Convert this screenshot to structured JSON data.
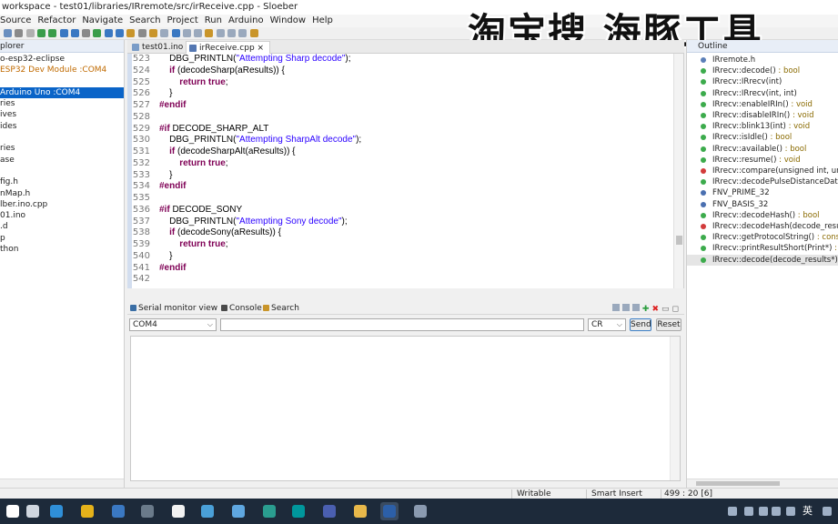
{
  "window": {
    "title": "workspace - test01/libraries/IRremote/src/irReceive.cpp - Sloeber"
  },
  "watermark": "淘宝搜 海豚工具",
  "menu": [
    "Source",
    "Refactor",
    "Navigate",
    "Search",
    "Project",
    "Run",
    "Arduino",
    "Window",
    "Help"
  ],
  "explorer": {
    "tab_label": "plorer",
    "items": [
      {
        "label": "o-esp32-eclipse"
      },
      {
        "label": " ESP32 Dev Module :COM4",
        "highlight": true
      },
      {
        "label": ""
      },
      {
        "label": "Arduino Uno :COM4",
        "selected": true
      },
      {
        "label": "ries"
      },
      {
        "label": "ives"
      },
      {
        "label": "ides"
      },
      {
        "label": ""
      },
      {
        "label": "ries"
      },
      {
        "label": "ase"
      },
      {
        "label": ""
      },
      {
        "label": "fig.h"
      },
      {
        "label": "nMap.h"
      },
      {
        "label": "lber.ino.cpp"
      },
      {
        "label": "01.ino"
      },
      {
        "label": ".d"
      },
      {
        "label": "p"
      },
      {
        "label": "thon"
      }
    ]
  },
  "editor": {
    "tabs": [
      {
        "label": "test01.ino",
        "active": false
      },
      {
        "label": "irReceive.cpp",
        "active": true
      }
    ],
    "lines": [
      {
        "n": "523",
        "parts": [
          [
            "t",
            "    DBG_PRINTLN("
          ],
          [
            "s",
            "\"Attempting Sharp decode\""
          ],
          [
            "t",
            ");"
          ]
        ]
      },
      {
        "n": "524",
        "parts": [
          [
            "k",
            "    if"
          ],
          [
            "t",
            " (decodeSharp(aResults)) {"
          ]
        ]
      },
      {
        "n": "525",
        "parts": [
          [
            "k",
            "        return true"
          ],
          [
            "t",
            ";"
          ]
        ]
      },
      {
        "n": "526",
        "parts": [
          [
            "t",
            "    }"
          ]
        ]
      },
      {
        "n": "527",
        "parts": [
          [
            "k",
            "#endif"
          ]
        ]
      },
      {
        "n": "528",
        "parts": [
          [
            "t",
            ""
          ]
        ]
      },
      {
        "n": "529",
        "parts": [
          [
            "k",
            "#if"
          ],
          [
            "t",
            " DECODE_SHARP_ALT"
          ]
        ]
      },
      {
        "n": "530",
        "parts": [
          [
            "t",
            "    DBG_PRINTLN("
          ],
          [
            "s",
            "\"Attempting SharpAlt decode\""
          ],
          [
            "t",
            ");"
          ]
        ]
      },
      {
        "n": "531",
        "parts": [
          [
            "k",
            "    if"
          ],
          [
            "t",
            " (decodeSharpAlt(aResults)) {"
          ]
        ]
      },
      {
        "n": "532",
        "parts": [
          [
            "k",
            "        return true"
          ],
          [
            "t",
            ";"
          ]
        ]
      },
      {
        "n": "533",
        "parts": [
          [
            "t",
            "    }"
          ]
        ]
      },
      {
        "n": "534",
        "parts": [
          [
            "k",
            "#endif"
          ]
        ]
      },
      {
        "n": "535",
        "parts": [
          [
            "t",
            ""
          ]
        ]
      },
      {
        "n": "536",
        "parts": [
          [
            "k",
            "#if"
          ],
          [
            "t",
            " DECODE_SONY"
          ]
        ]
      },
      {
        "n": "537",
        "parts": [
          [
            "t",
            "    DBG_PRINTLN("
          ],
          [
            "s",
            "\"Attempting Sony decode\""
          ],
          [
            "t",
            ");"
          ]
        ]
      },
      {
        "n": "538",
        "parts": [
          [
            "k",
            "    if"
          ],
          [
            "t",
            " (decodeSony(aResults)) {"
          ]
        ]
      },
      {
        "n": "539",
        "parts": [
          [
            "k",
            "        return true"
          ],
          [
            "t",
            ";"
          ]
        ]
      },
      {
        "n": "540",
        "parts": [
          [
            "t",
            "    }"
          ]
        ]
      },
      {
        "n": "541",
        "parts": [
          [
            "k",
            "#endif"
          ]
        ]
      },
      {
        "n": "542",
        "parts": [
          [
            "t",
            ""
          ]
        ]
      }
    ]
  },
  "bottom": {
    "tabs": [
      "Serial monitor view",
      "Console",
      "Search"
    ],
    "port": "COM4",
    "line_ending": "CR",
    "send_label": "Send",
    "reset_label": "Reset",
    "input_value": ""
  },
  "outline": {
    "tab_label": "Outline",
    "items": [
      {
        "name": "IRremote.h",
        "ret": "",
        "color": "#5b7fb8"
      },
      {
        "name": "IRrecv::decode()",
        "ret": " : bool",
        "color": "#3cab4c"
      },
      {
        "name": "IRrecv::IRrecv(int)",
        "ret": "",
        "color": "#3cab4c"
      },
      {
        "name": "IRrecv::IRrecv(int, int)",
        "ret": "",
        "color": "#3cab4c"
      },
      {
        "name": "IRrecv::enableIRIn()",
        "ret": " : void",
        "color": "#3cab4c"
      },
      {
        "name": "IRrecv::disableIRIn()",
        "ret": " : void",
        "color": "#3cab4c"
      },
      {
        "name": "IRrecv::blink13(int)",
        "ret": " : void",
        "color": "#3cab4c"
      },
      {
        "name": "IRrecv::isIdle()",
        "ret": " : bool",
        "color": "#3cab4c"
      },
      {
        "name": "IRrecv::available()",
        "ret": " : bool",
        "color": "#3cab4c"
      },
      {
        "name": "IRrecv::resume()",
        "ret": " : void",
        "color": "#3cab4c"
      },
      {
        "name": "IRrecv::compare(unsigned int, unsigne",
        "ret": "",
        "color": "#d23b3b"
      },
      {
        "name": "IRrecv::decodePulseDistanceData(ui",
        "ret": "",
        "color": "#3cab4c"
      },
      {
        "name": "FNV_PRIME_32",
        "ret": "",
        "color": "#4a6fb0"
      },
      {
        "name": "FNV_BASIS_32",
        "ret": "",
        "color": "#4a6fb0"
      },
      {
        "name": "IRrecv::decodeHash()",
        "ret": " : bool",
        "color": "#3cab4c"
      },
      {
        "name": "IRrecv::decodeHash(decode_results",
        "ret": "",
        "color": "#d23b3b"
      },
      {
        "name": "IRrecv::getProtocolString()",
        "ret": " : const c",
        "color": "#3cab4c"
      },
      {
        "name": "IRrecv::printResultShort(Print*)",
        "ret": " : voi",
        "color": "#3cab4c"
      },
      {
        "name": "IRrecv::decode(decode_results*)",
        "ret": " : bo",
        "color": "#3cab4c",
        "selected": true
      }
    ]
  },
  "status": {
    "writable": "Writable",
    "insert_mode": "Smart Insert",
    "position": "499 : 20 [6]"
  },
  "taskbar": {
    "ime": "英"
  },
  "colors": {
    "selection": "#0a64c8",
    "keyword": "#7f0055",
    "string": "#2a00ff",
    "taskbar": "#1d2a3a"
  }
}
